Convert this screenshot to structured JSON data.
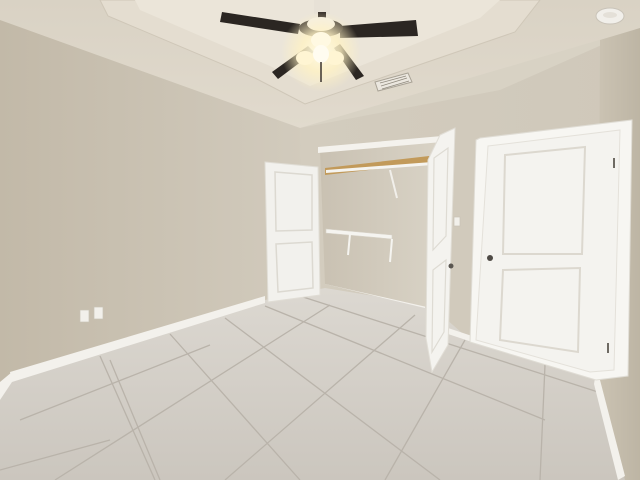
{
  "scene": {
    "subject": "empty-bedroom-interior",
    "objects": [
      "ceiling-fan-icon",
      "ceiling-light-icon",
      "air-vent-icon",
      "smoke-detector-icon",
      "open-closet",
      "closet-shelf",
      "closet-door",
      "entry-door",
      "door-knob-icon",
      "electrical-outlet-icon",
      "tile-floor",
      "baseboard"
    ],
    "colors": {
      "wall_left": "#cdc5b5",
      "wall_back": "#d6cfc1",
      "wall_right": "#c9c1b1",
      "ceiling": "#ddd6c8",
      "tray_ceiling": "#e6dfd2",
      "floor": "#d7d3cc",
      "grout": "#b9b3aa",
      "door": "#f4f3ef",
      "trim": "#f7f6f2",
      "fan_blade": "#2b2622",
      "light_glow": "#fff6d0"
    }
  }
}
